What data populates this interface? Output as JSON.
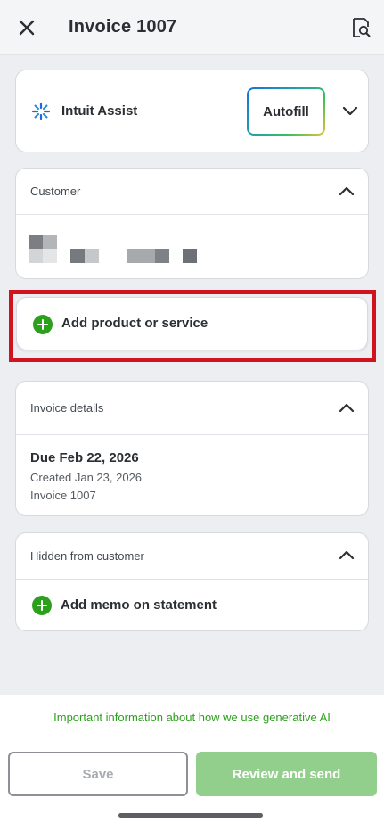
{
  "header": {
    "title": "Invoice 1007",
    "close_icon": "close-icon",
    "preview_icon": "document-search-icon"
  },
  "intuit_assist": {
    "label": "Intuit Assist",
    "autofill_label": "Autofill",
    "icon": "sparkle-icon"
  },
  "customer": {
    "heading": "Customer"
  },
  "add_product": {
    "label": "Add product or service"
  },
  "invoice_details": {
    "heading": "Invoice details",
    "due": "Due Feb 22, 2026",
    "created": "Created Jan 23, 2026",
    "invoice_number": "Invoice 1007"
  },
  "hidden_from_customer": {
    "heading": "Hidden from customer",
    "memo_label": "Add memo on statement"
  },
  "footer": {
    "gen_ai_notice": "Important information about how we use generative AI",
    "save_label": "Save",
    "review_label": "Review and send"
  },
  "colors": {
    "accent_green": "#2ca01c",
    "review_button": "#93cf8c",
    "highlight_red": "#d0131e"
  }
}
